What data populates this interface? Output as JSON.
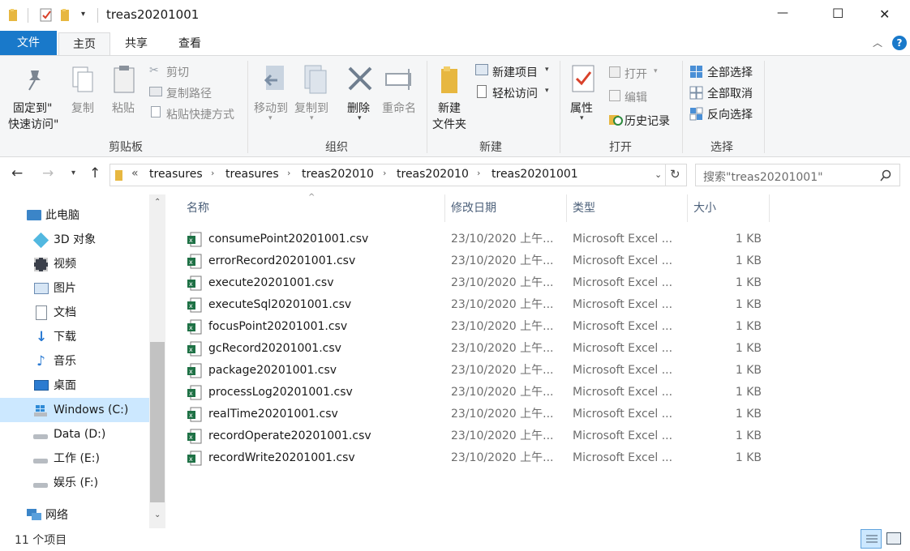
{
  "window": {
    "title": "treas20201001",
    "minimize_glyph": "—",
    "maximize_glyph": "☐",
    "close_glyph": "✕"
  },
  "ribbon_tabs": {
    "file": "文件",
    "home": "主页",
    "share": "共享",
    "view": "查看",
    "help_glyph": "?"
  },
  "ribbon": {
    "clipboard": {
      "pin_line1": "固定到\"",
      "pin_line2": "快速访问\"",
      "copy": "复制",
      "paste": "粘贴",
      "cut": "剪切",
      "copy_path": "复制路径",
      "paste_shortcut": "粘贴快捷方式",
      "group": "剪贴板"
    },
    "organize": {
      "move_to": "移动到",
      "copy_to": "复制到",
      "delete": "删除",
      "rename": "重命名",
      "group": "组织"
    },
    "new": {
      "new_folder_line1": "新建",
      "new_folder_line2": "文件夹",
      "new_item": "新建项目",
      "easy_access": "轻松访问",
      "group": "新建"
    },
    "open": {
      "properties": "属性",
      "open": "打开",
      "edit": "编辑",
      "history": "历史记录",
      "group": "打开"
    },
    "select": {
      "select_all": "全部选择",
      "select_none": "全部取消",
      "invert": "反向选择",
      "group": "选择"
    }
  },
  "address": {
    "overflow": "«",
    "crumbs": [
      "treasures",
      "treasures",
      "treas202010",
      "treas202010",
      "treas20201001"
    ],
    "search_placeholder": "搜索\"treas20201001\""
  },
  "sidebar": {
    "items": [
      {
        "label": "此电脑",
        "icon": "computer-icon"
      },
      {
        "label": "3D 对象",
        "icon": "3d-objects-icon"
      },
      {
        "label": "视频",
        "icon": "video-icon"
      },
      {
        "label": "图片",
        "icon": "pictures-icon"
      },
      {
        "label": "文档",
        "icon": "documents-icon"
      },
      {
        "label": "下载",
        "icon": "download-icon"
      },
      {
        "label": "音乐",
        "icon": "music-icon"
      },
      {
        "label": "桌面",
        "icon": "desktop-icon"
      },
      {
        "label": "Windows (C:)",
        "icon": "windows-drive-icon",
        "selected": true
      },
      {
        "label": "Data (D:)",
        "icon": "drive-icon"
      },
      {
        "label": "工作 (E:)",
        "icon": "drive-icon"
      },
      {
        "label": "娱乐 (F:)",
        "icon": "drive-icon"
      },
      {
        "label": "网络",
        "icon": "network-icon"
      }
    ]
  },
  "columns": {
    "name": "名称",
    "date": "修改日期",
    "type": "类型",
    "size": "大小"
  },
  "files": [
    {
      "name": "consumePoint20201001.csv",
      "date": "23/10/2020 上午...",
      "type": "Microsoft Excel ...",
      "size": "1 KB"
    },
    {
      "name": "errorRecord20201001.csv",
      "date": "23/10/2020 上午...",
      "type": "Microsoft Excel ...",
      "size": "1 KB"
    },
    {
      "name": "execute20201001.csv",
      "date": "23/10/2020 上午...",
      "type": "Microsoft Excel ...",
      "size": "1 KB"
    },
    {
      "name": "executeSql20201001.csv",
      "date": "23/10/2020 上午...",
      "type": "Microsoft Excel ...",
      "size": "1 KB"
    },
    {
      "name": "focusPoint20201001.csv",
      "date": "23/10/2020 上午...",
      "type": "Microsoft Excel ...",
      "size": "1 KB"
    },
    {
      "name": "gcRecord20201001.csv",
      "date": "23/10/2020 上午...",
      "type": "Microsoft Excel ...",
      "size": "1 KB"
    },
    {
      "name": "package20201001.csv",
      "date": "23/10/2020 上午...",
      "type": "Microsoft Excel ...",
      "size": "1 KB"
    },
    {
      "name": "processLog20201001.csv",
      "date": "23/10/2020 上午...",
      "type": "Microsoft Excel ...",
      "size": "1 KB"
    },
    {
      "name": "realTime20201001.csv",
      "date": "23/10/2020 上午...",
      "type": "Microsoft Excel ...",
      "size": "1 KB"
    },
    {
      "name": "recordOperate20201001.csv",
      "date": "23/10/2020 上午...",
      "type": "Microsoft Excel ...",
      "size": "1 KB"
    },
    {
      "name": "recordWrite20201001.csv",
      "date": "23/10/2020 上午...",
      "type": "Microsoft Excel ...",
      "size": "1 KB"
    }
  ],
  "status": {
    "count": "11 个项目"
  },
  "colors": {
    "accent": "#1979ca",
    "selected_bg": "#cce8ff",
    "excel_green": "#1e7145"
  }
}
